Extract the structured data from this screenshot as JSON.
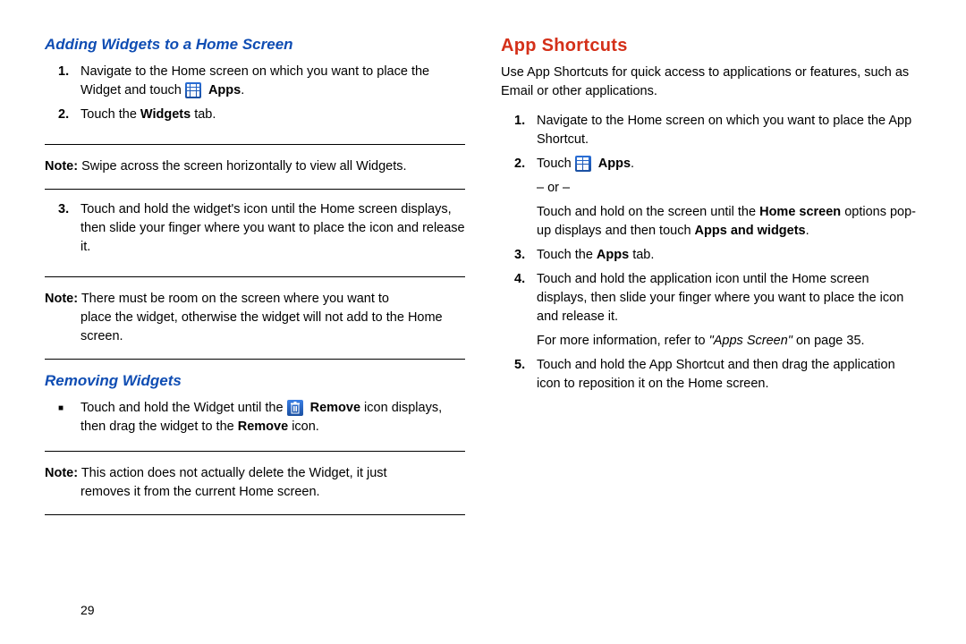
{
  "left": {
    "h1": "Adding Widgets to a Home Screen",
    "step1_a": "Navigate to the Home screen on which you want to place the Widget and touch ",
    "step1_b": "Apps",
    "step1_c": ".",
    "step2_a": "Touch the ",
    "step2_b": "Widgets",
    "step2_c": " tab.",
    "note1_label": "Note:",
    "note1_body": " Swipe across the screen horizontally to view all Widgets.",
    "step3": "Touch and hold the widget's icon until the Home screen displays, then slide your finger where you want to place the icon and release it.",
    "note2_label": "Note:",
    "note2_first": " There must be room on the screen where you want to",
    "note2_rest": "place the widget, otherwise the widget will not add to the Home screen.",
    "h2": "Removing Widgets",
    "remove_a": "Touch and hold the Widget until the ",
    "remove_b": "Remove",
    "remove_c": " icon displays, then drag the widget to the ",
    "remove_d": "Remove",
    "remove_e": " icon.",
    "note3_label": "Note:",
    "note3_first": " This action does not actually delete the Widget, it just",
    "note3_rest": "removes it from the current Home screen."
  },
  "right": {
    "h1": "App Shortcuts",
    "intro": "Use App Shortcuts for quick access to applications or features, such as Email or other applications.",
    "step1": "Navigate to the Home screen on which you want to place the App Shortcut.",
    "step2_a": "Touch ",
    "step2_b": "Apps",
    "step2_c": ".",
    "or": "– or –",
    "step2_alt_a": "Touch and hold on the screen until the ",
    "step2_alt_b": "Home screen",
    "step2_alt_c": " options pop-up displays and then touch ",
    "step2_alt_d": "Apps and widgets",
    "step2_alt_e": ".",
    "step3_a": "Touch the ",
    "step3_b": "Apps",
    "step3_c": " tab.",
    "step4": "Touch and hold the application icon until the Home screen displays, then slide your finger where you want to place the icon and release it.",
    "ref_a": "For more information, refer to ",
    "ref_b": "\"Apps Screen\"",
    "ref_c": " on page 35.",
    "step5": "Touch and hold the App Shortcut and then drag the application icon to reposition it on the Home screen."
  },
  "page_number": "29"
}
